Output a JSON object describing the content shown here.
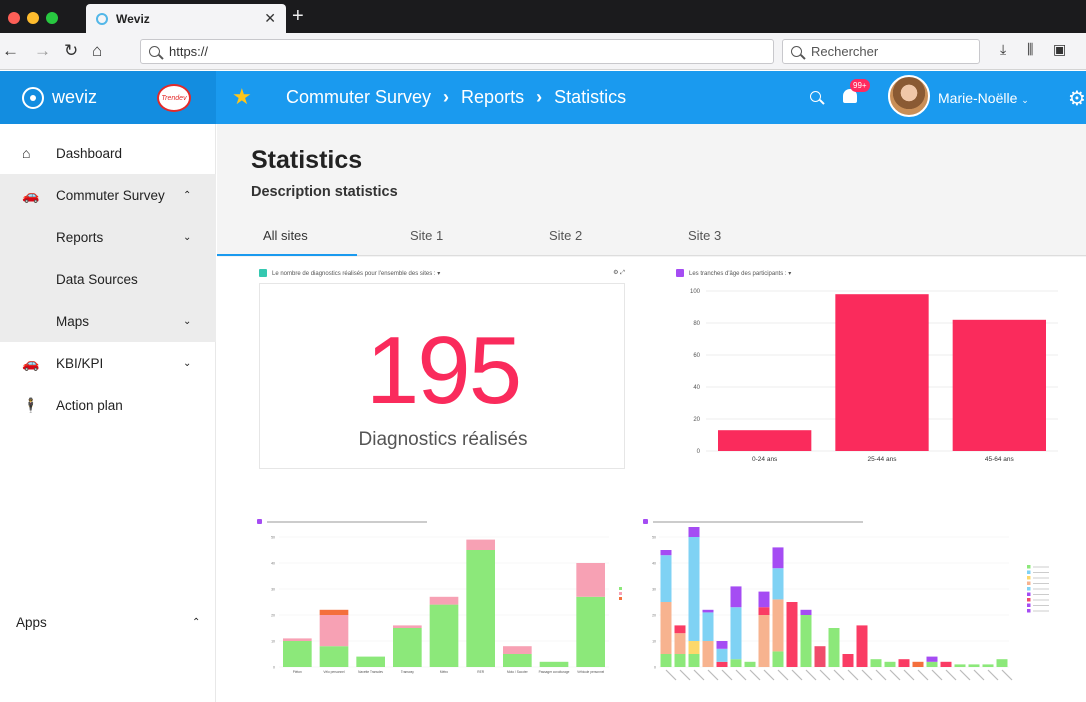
{
  "browser": {
    "tab_title": "Weviz",
    "url": "https://",
    "search_placeholder": "Rechercher"
  },
  "header": {
    "brand": "weviz",
    "partner_logo_text": "Trendev",
    "breadcrumb": [
      "Commuter Survey",
      "Reports",
      "Statistics"
    ],
    "notifications": "99+",
    "user": "Marie-Noëlle"
  },
  "sidebar": {
    "items": [
      {
        "label": "Dashboard",
        "icon": "home-icon"
      },
      {
        "label": "Commuter Survey",
        "icon": "car-icon",
        "chevron": "up"
      },
      {
        "label": "Reports",
        "chevron": "down"
      },
      {
        "label": "Data Sources"
      },
      {
        "label": "Maps",
        "chevron": "down"
      },
      {
        "label": "KBI/KPI",
        "icon": "car-icon",
        "chevron": "down"
      },
      {
        "label": "Action plan",
        "icon": "person-icon"
      }
    ],
    "apps_label": "Apps"
  },
  "page": {
    "title": "Statistics",
    "subtitle": "Description statistics",
    "tabs": [
      "All sites",
      "Site 1",
      "Site 2",
      "Site 3"
    ],
    "active_tab": 0
  },
  "kpi": {
    "header": "Le nombre de diagnostics réalisés pour l'ensemble des sites : ▾",
    "value": "195",
    "label": "Diagnostics réalisés"
  },
  "colors": {
    "accent": "#1a9aef",
    "brand_red": "#fa2b5c",
    "green": "#8ce87a",
    "pink": "#f7a1b4",
    "orange": "#f46f3c",
    "blue_light": "#7fd2f4",
    "purple": "#a54cf3"
  },
  "chart_data": [
    {
      "type": "bar",
      "title": "Les tranches d'âge des participants : ▾",
      "categories": [
        "0-24 ans",
        "25-44 ans",
        "45-64 ans"
      ],
      "values": [
        13,
        98,
        82
      ],
      "ylim": [
        0,
        100
      ],
      "yticks": [
        0,
        20,
        40,
        60,
        80,
        100
      ],
      "color": "#fa2b5c",
      "grid": true
    },
    {
      "type": "bar",
      "stacked": true,
      "categories": [
        "Piéton",
        "Vélo personnel",
        "Navette Transdev",
        "Tramway",
        "Métro",
        "RER",
        "Moto / Scooter",
        "Passager covoiturage",
        "Véhicule personnel"
      ],
      "series": [
        {
          "color": "#8ce87a",
          "values": [
            10,
            8,
            4,
            15,
            24,
            45,
            5,
            2,
            27
          ]
        },
        {
          "color": "#f7a1b4",
          "values": [
            1,
            12,
            0,
            1,
            3,
            4,
            3,
            0,
            13
          ]
        },
        {
          "color": "#f46f3c",
          "values": [
            0,
            2,
            0,
            0,
            0,
            0,
            0,
            0,
            0
          ]
        }
      ],
      "ylim": [
        0,
        50
      ],
      "yticks": [
        0,
        10,
        20,
        30,
        40,
        50
      ],
      "legend_position": "right"
    },
    {
      "type": "bar",
      "stacked": true,
      "legend_position": "right",
      "colors": [
        "#8ce87a",
        "#7fd2f4",
        "#fcd86b",
        "#f7b38f",
        "#7fd2f4",
        "#a54cf3",
        "#f04c6b",
        "#a54cf3",
        "#a54cf3"
      ],
      "ylim": [
        0,
        50
      ],
      "yticks": [
        0,
        10,
        20,
        30,
        40,
        50
      ],
      "stacks": [
        [
          [
            5,
            "#8ce87a"
          ],
          [
            20,
            "#f7b38f"
          ],
          [
            18,
            "#7fd2f4"
          ],
          [
            2,
            "#a54cf3"
          ]
        ],
        [
          [
            5,
            "#8ce87a"
          ],
          [
            8,
            "#f7b38f"
          ],
          [
            3,
            "#fa3c64"
          ]
        ],
        [
          [
            5,
            "#8ce87a"
          ],
          [
            5,
            "#fcd86b"
          ],
          [
            40,
            "#7fd2f4"
          ],
          [
            10,
            "#a54cf3"
          ]
        ],
        [
          [
            10,
            "#f7b38f"
          ],
          [
            11,
            "#7fd2f4"
          ],
          [
            1,
            "#a54cf3"
          ]
        ],
        [
          [
            2,
            "#fa3c64"
          ],
          [
            5,
            "#7fd2f4"
          ],
          [
            3,
            "#a54cf3"
          ]
        ],
        [
          [
            3,
            "#8ce87a"
          ],
          [
            20,
            "#7fd2f4"
          ],
          [
            8,
            "#a54cf3"
          ]
        ],
        [
          [
            2,
            "#8ce87a"
          ]
        ],
        [
          [
            20,
            "#f7b38f"
          ],
          [
            3,
            "#fa3c64"
          ],
          [
            6,
            "#a54cf3"
          ]
        ],
        [
          [
            6,
            "#8ce87a"
          ],
          [
            20,
            "#f7b38f"
          ],
          [
            12,
            "#7fd2f4"
          ],
          [
            8,
            "#a54cf3"
          ]
        ],
        [
          [
            25,
            "#fa3c64"
          ]
        ],
        [
          [
            20,
            "#8ce87a"
          ],
          [
            2,
            "#a54cf3"
          ]
        ],
        [
          [
            8,
            "#f04c6b"
          ]
        ],
        [
          [
            15,
            "#8ce87a"
          ]
        ],
        [
          [
            5,
            "#fa3c64"
          ]
        ],
        [
          [
            16,
            "#fa3c64"
          ]
        ],
        [
          [
            3,
            "#8ce87a"
          ]
        ],
        [
          [
            2,
            "#8ce87a"
          ]
        ],
        [
          [
            3,
            "#fa3c64"
          ]
        ],
        [
          [
            2,
            "#f46f3c"
          ]
        ],
        [
          [
            2,
            "#8ce87a"
          ],
          [
            2,
            "#a54cf3"
          ]
        ],
        [
          [
            2,
            "#fa3c64"
          ]
        ],
        [
          [
            1,
            "#8ce87a"
          ]
        ],
        [
          [
            1,
            "#8ce87a"
          ]
        ],
        [
          [
            1,
            "#8ce87a"
          ]
        ],
        [
          [
            3,
            "#8ce87a"
          ]
        ]
      ]
    }
  ]
}
